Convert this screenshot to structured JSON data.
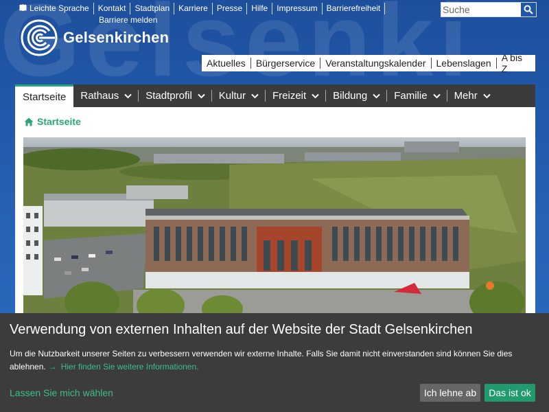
{
  "service_nav": {
    "items": [
      "Leichte Sprache",
      "Kontakt",
      "Stadtplan",
      "Karriere",
      "Presse",
      "Hilfe",
      "Impressum",
      "Barrierefreiheit",
      "Barriere melden"
    ]
  },
  "search": {
    "placeholder": "Suche"
  },
  "logo": {
    "name": "Gelsenkirchen"
  },
  "quick_nav": {
    "items": [
      "Aktuelles",
      "Bürgerservice",
      "Veranstaltungskalender",
      "Lebenslagen",
      "A bis Z"
    ]
  },
  "main_nav": {
    "tabs": [
      "Startseite",
      "Rathaus",
      "Stadtprofil",
      "Kultur",
      "Freizeit",
      "Bildung",
      "Familie",
      "Mehr"
    ],
    "active": "Startseite"
  },
  "breadcrumb": {
    "label": "Startseite"
  },
  "cookie": {
    "title": "Verwendung von externen Inhalten auf der Website der Stadt Gelsenkirchen",
    "text": "Um die Nutzbarkeit unserer Seiten zu verbessern verwenden wir externe Inhalte. Falls Sie damit nicht einverstanden sind können Sie dies ablehnen.",
    "more_link": "Hier finden Sie weitere Informationen.",
    "choose_link": "Lassen Sie mich wählen",
    "decline": "Ich lehne ab",
    "accept": "Das ist ok"
  },
  "colors": {
    "brand_blue": "#1f56a5",
    "accent_green": "#2aa57b",
    "nav_dark": "#3b3b3b",
    "banner_bg": "#3c3c3c"
  }
}
